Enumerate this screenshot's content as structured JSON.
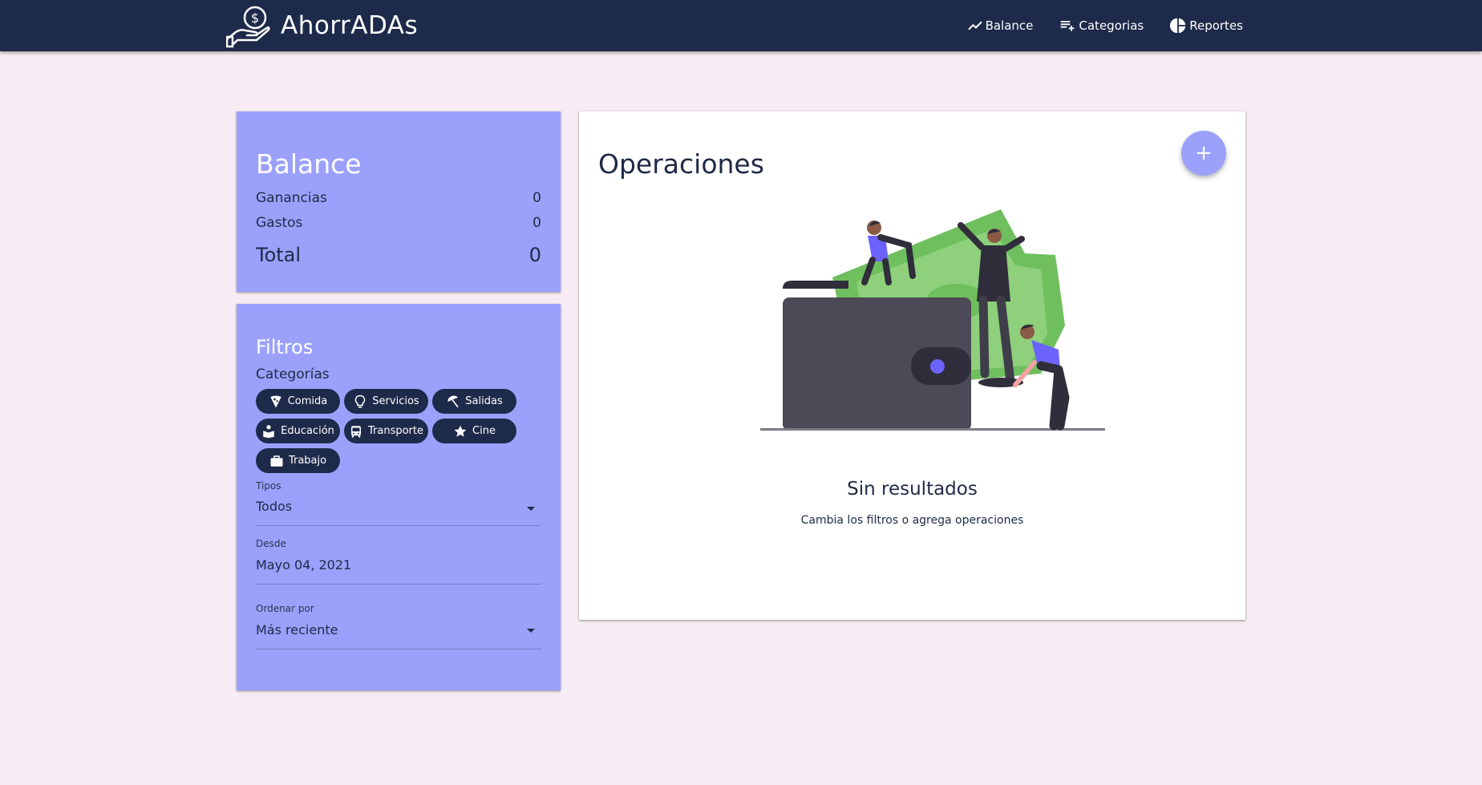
{
  "app": {
    "title": "AhorrADAs",
    "logo_icon": "hand-coin-icon"
  },
  "nav": {
    "items": [
      {
        "label": "Balance",
        "icon": "trending-up-icon"
      },
      {
        "label": "Categorias",
        "icon": "playlist-add-icon"
      },
      {
        "label": "Reportes",
        "icon": "pie-chart-icon"
      }
    ]
  },
  "balance": {
    "title": "Balance",
    "rows": [
      {
        "label": "Ganancias",
        "value": "0"
      },
      {
        "label": "Gastos",
        "value": "0"
      }
    ],
    "total_label": "Total",
    "total_value": "0"
  },
  "filters": {
    "title": "Filtros",
    "categories_label": "Categorías",
    "categories": [
      {
        "label": "Comida",
        "icon": "pizza-icon"
      },
      {
        "label": "Servicios",
        "icon": "lightbulb-icon"
      },
      {
        "label": "Salidas",
        "icon": "umbrella-beach-icon"
      },
      {
        "label": "Educación",
        "icon": "book-reader-icon"
      },
      {
        "label": "Transporte",
        "icon": "bus-icon"
      },
      {
        "label": "Cine",
        "icon": "star-icon"
      },
      {
        "label": "Trabajo",
        "icon": "briefcase-icon"
      }
    ],
    "type_label": "Tipos",
    "type_value": "Todos",
    "from_label": "Desde",
    "from_value": "Mayo 04, 2021",
    "order_label": "Ordenar por",
    "order_value": "Más reciente"
  },
  "operations": {
    "title": "Operaciones",
    "add_label": "+",
    "empty_title": "Sin resultados",
    "empty_subtitle": "Cambia los filtros o agrega operaciones"
  },
  "colors": {
    "navbar": "#1e2a4a",
    "accent": "#9ba1fb",
    "background": "#f7ecf3"
  }
}
